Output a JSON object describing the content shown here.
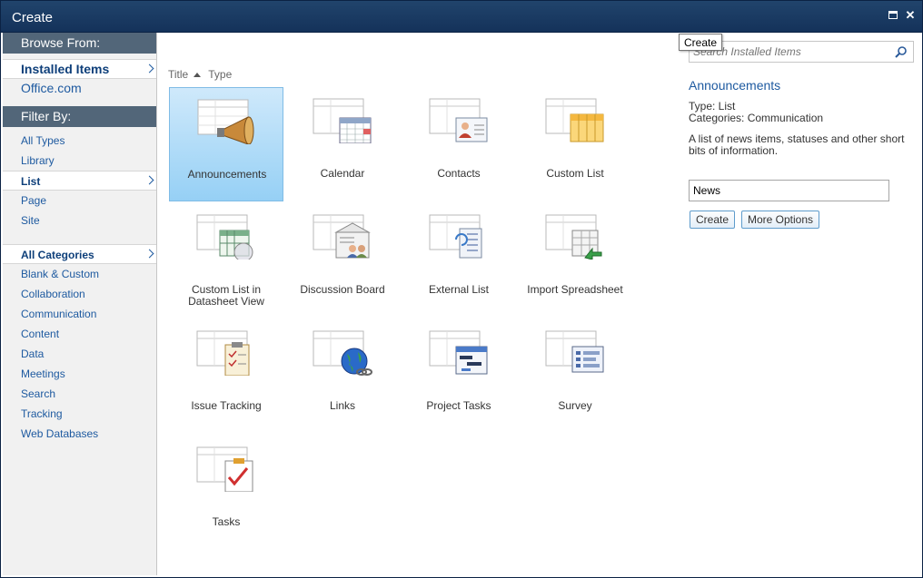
{
  "window": {
    "title": "Create"
  },
  "nav": {
    "browse_header": "Browse From:",
    "browse_items": [
      {
        "label": "Installed Items",
        "selected": true
      },
      {
        "label": "Office.com",
        "selected": false
      }
    ],
    "filter_header": "Filter By:",
    "type_items": [
      {
        "label": "All Types",
        "selected": false
      },
      {
        "label": "Library",
        "selected": false
      },
      {
        "label": "List",
        "selected": true
      },
      {
        "label": "Page",
        "selected": false
      },
      {
        "label": "Site",
        "selected": false
      }
    ],
    "category_items": [
      {
        "label": "All Categories",
        "selected": true
      },
      {
        "label": "Blank & Custom",
        "selected": false
      },
      {
        "label": "Collaboration",
        "selected": false
      },
      {
        "label": "Communication",
        "selected": false
      },
      {
        "label": "Content",
        "selected": false
      },
      {
        "label": "Data",
        "selected": false
      },
      {
        "label": "Meetings",
        "selected": false
      },
      {
        "label": "Search",
        "selected": false
      },
      {
        "label": "Tracking",
        "selected": false
      },
      {
        "label": "Web Databases",
        "selected": false
      }
    ]
  },
  "sort": {
    "title_label": "Title",
    "type_label": "Type"
  },
  "templates": [
    {
      "label": "Announcements",
      "icon": "megaphone-icon",
      "selected": true
    },
    {
      "label": "Calendar",
      "icon": "calendar-icon",
      "selected": false
    },
    {
      "label": "Contacts",
      "icon": "contact-card-icon",
      "selected": false
    },
    {
      "label": "Custom List",
      "icon": "custom-list-icon",
      "selected": false
    },
    {
      "label": "Custom List in Datasheet View",
      "icon": "datasheet-icon",
      "selected": false
    },
    {
      "label": "Discussion Board",
      "icon": "discussion-icon",
      "selected": false
    },
    {
      "label": "External List",
      "icon": "external-list-icon",
      "selected": false
    },
    {
      "label": "Import Spreadsheet",
      "icon": "spreadsheet-import-icon",
      "selected": false
    },
    {
      "label": "Issue Tracking",
      "icon": "clipboard-issue-icon",
      "selected": false
    },
    {
      "label": "Links",
      "icon": "globe-link-icon",
      "selected": false
    },
    {
      "label": "Project Tasks",
      "icon": "gantt-icon",
      "selected": false
    },
    {
      "label": "Survey",
      "icon": "survey-icon",
      "selected": false
    },
    {
      "label": "Tasks",
      "icon": "clipboard-check-icon",
      "selected": false
    }
  ],
  "search": {
    "placeholder": "Search Installed Items",
    "tooltip": "Create"
  },
  "detail": {
    "title": "Announcements",
    "type_line": "Type: List",
    "categories_line": "Categories: Communication",
    "description": "A list of news items, statuses and other short bits of information.",
    "name_value": "News",
    "create_label": "Create",
    "more_options_label": "More Options"
  },
  "colors": {
    "accent": "#1e5aa0",
    "titlebar": "#1b3a63",
    "nav_header": "#526679",
    "tile_selected": "#96d0f5"
  }
}
